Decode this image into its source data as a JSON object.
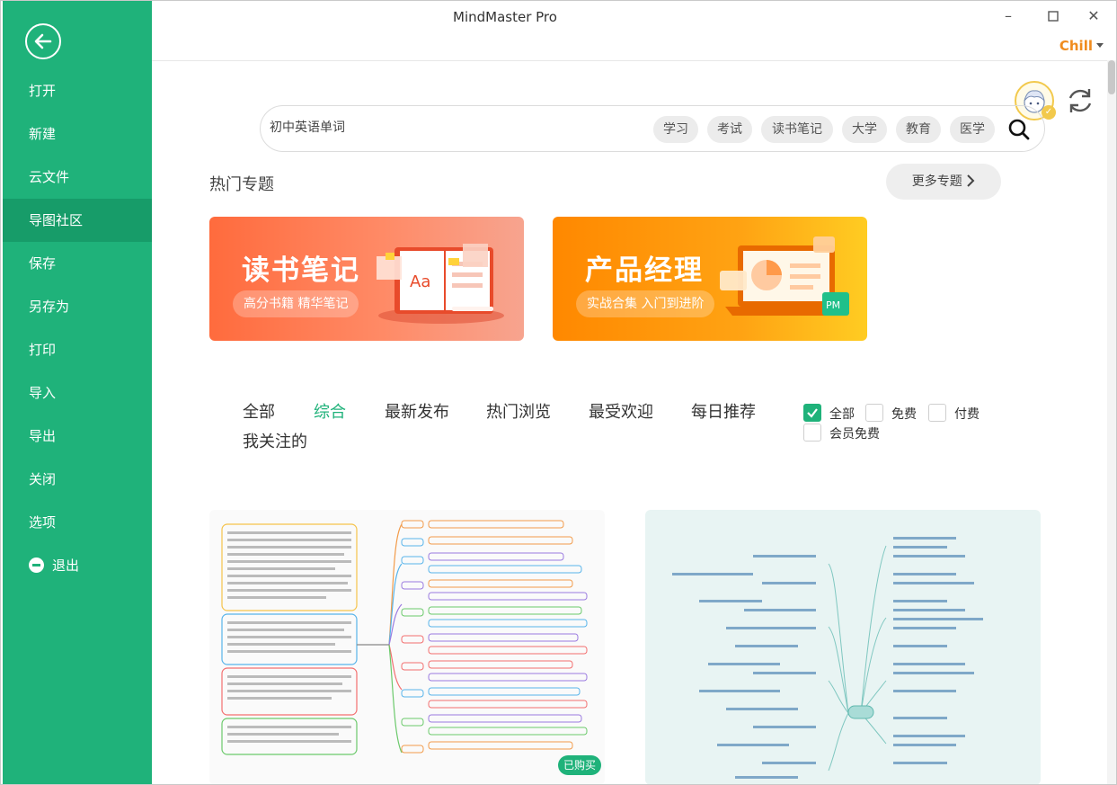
{
  "window": {
    "title": "MindMaster Pro",
    "user": "Chill"
  },
  "sidebar": {
    "items": [
      {
        "label": "打开",
        "active": false
      },
      {
        "label": "新建",
        "active": false
      },
      {
        "label": "云文件",
        "active": false
      },
      {
        "label": "导图社区",
        "active": true
      },
      {
        "label": "保存",
        "active": false
      },
      {
        "label": "另存为",
        "active": false
      },
      {
        "label": "打印",
        "active": false
      },
      {
        "label": "导入",
        "active": false
      },
      {
        "label": "导出",
        "active": false
      },
      {
        "label": "关闭",
        "active": false
      },
      {
        "label": "选项",
        "active": false
      }
    ],
    "exit_label": "退出"
  },
  "search": {
    "value": "初中英语单词",
    "tags": [
      "学习",
      "考试",
      "读书笔记",
      "大学",
      "教育",
      "医学"
    ]
  },
  "hot": {
    "title": "热门专题",
    "more_label": "更多专题",
    "banners": [
      {
        "title": "读书笔记",
        "subtitle": "高分书籍 精华笔记",
        "art_text": "Aa"
      },
      {
        "title": "产品经理",
        "subtitle": "实战合集 入门到进阶",
        "art_text": "PM"
      }
    ]
  },
  "filters": {
    "tabs": [
      "全部",
      "综合",
      "最新发布",
      "热门浏览",
      "最受欢迎",
      "每日推荐",
      "我关注的"
    ],
    "active_tab": "综合",
    "price": [
      {
        "label": "全部",
        "checked": true
      },
      {
        "label": "免费",
        "checked": false
      },
      {
        "label": "付费",
        "checked": false
      },
      {
        "label": "会员免费",
        "checked": false
      }
    ]
  },
  "cards": [
    {
      "badge": "已购买"
    },
    {
      "badge": ""
    }
  ],
  "colors": {
    "accent": "#1fb27a",
    "accent_dark": "#179c69",
    "user": "#f08c1e"
  }
}
